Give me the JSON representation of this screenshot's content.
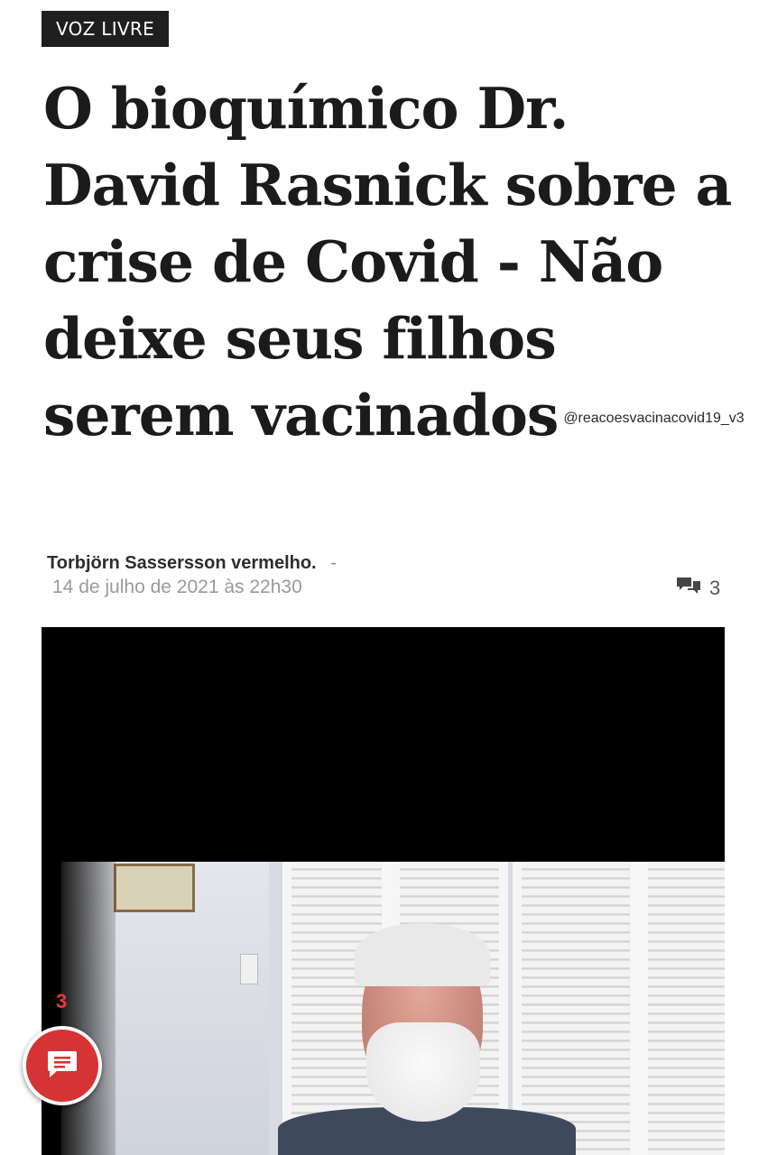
{
  "category": {
    "label": "VOZ LIVRE"
  },
  "article": {
    "title": "O bioquímico Dr. David Rasnick sobre a crise de Covid - Não deixe seus filhos serem vacinados",
    "watermark": "@reacoesvacinacovid19_v3",
    "author": "Torbjörn Sassersson vermelho.",
    "separator": "-",
    "date": "14 de julho de 2021 às 22h30",
    "comment_count": "3"
  },
  "floating": {
    "badge_count": "3"
  },
  "icons": {
    "comments": "comments-icon",
    "chat": "chat-icon"
  },
  "colors": {
    "tag_bg": "#1f1f1f",
    "chat_button": "#d63434",
    "badge": "#e23b3b"
  }
}
